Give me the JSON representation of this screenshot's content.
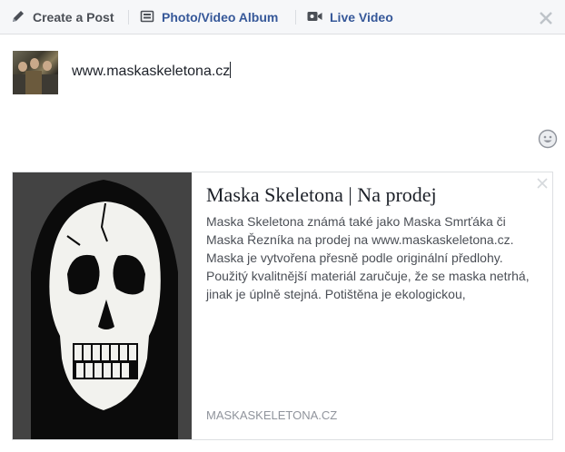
{
  "tabs": {
    "create_post": "Create a Post",
    "photo_album": "Photo/Video Album",
    "live_video": "Live Video"
  },
  "icons": {
    "pencil": "pencil-icon",
    "photo": "photo-album-icon",
    "video": "video-camera-icon",
    "close": "close-icon",
    "emoji": "emoji-icon"
  },
  "composer": {
    "text": "www.maskaskeletona.cz"
  },
  "link_preview": {
    "title": "Maska Skeletona | Na prodej",
    "description": "Maska Skeletona známá také jako Maska Smrťáka či Maska Řezníka na prodej na www.maskaskeletona.cz. Maska je vytvořena přesně podle originální předlohy. Použitý kvalitnější materiál zaručuje, že se maska netrhá, jinak je úplně stejná. Potištěna je ekologickou,",
    "domain": "MASKASKELETONA.CZ"
  },
  "colors": {
    "link_blue": "#365899",
    "tab_bar_bg": "#f6f7f9",
    "muted_text": "#90949c"
  }
}
